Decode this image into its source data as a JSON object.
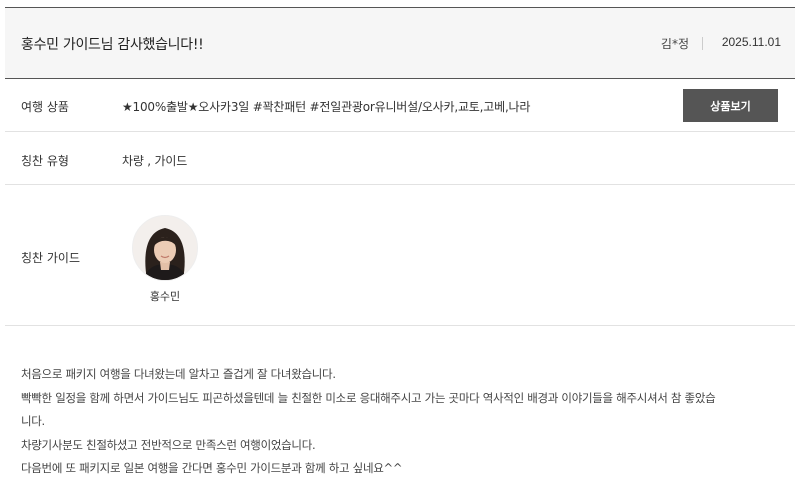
{
  "review": {
    "title": "홍수민 가이드님 감사했습니다!!",
    "author": "김*정",
    "date": "2025.11.01"
  },
  "product": {
    "label": "여행 상품",
    "name": "★100%출발★오사카3일 #꽉찬패턴 #전일관광or유니버설/오사카,교토,고베,나라",
    "button_label": "상품보기"
  },
  "praise_type": {
    "label": "칭찬 유형",
    "value": "차량 , 가이드"
  },
  "praise_guide": {
    "label": "칭찬 가이드",
    "guide_name": "홍수민",
    "photo_icon": "guide-profile-photo"
  },
  "content": {
    "lines": [
      "처음으로 패키지 여행을 다녀왔는데 알차고 즐겁게 잘 다녀왔습니다.",
      "빡빡한 일정을 함께 하면서 가이드님도 피곤하셨을텐데 늘 친절한 미소로 응대해주시고 가는 곳마다 역사적인 배경과 이야기들을 해주시셔서 참 좋았습",
      "니다.",
      "차량기사분도 친절하셨고 전반적으로 만족스런 여행이었습니다.",
      "다음번에 또 패키지로 일본 여행을 간다면 홍수민 가이드분과 함께 하고 싶네요^^"
    ]
  },
  "colors": {
    "header_bg": "#f6f6f6",
    "button_bg": "#555555",
    "border": "#e2e2e2"
  }
}
